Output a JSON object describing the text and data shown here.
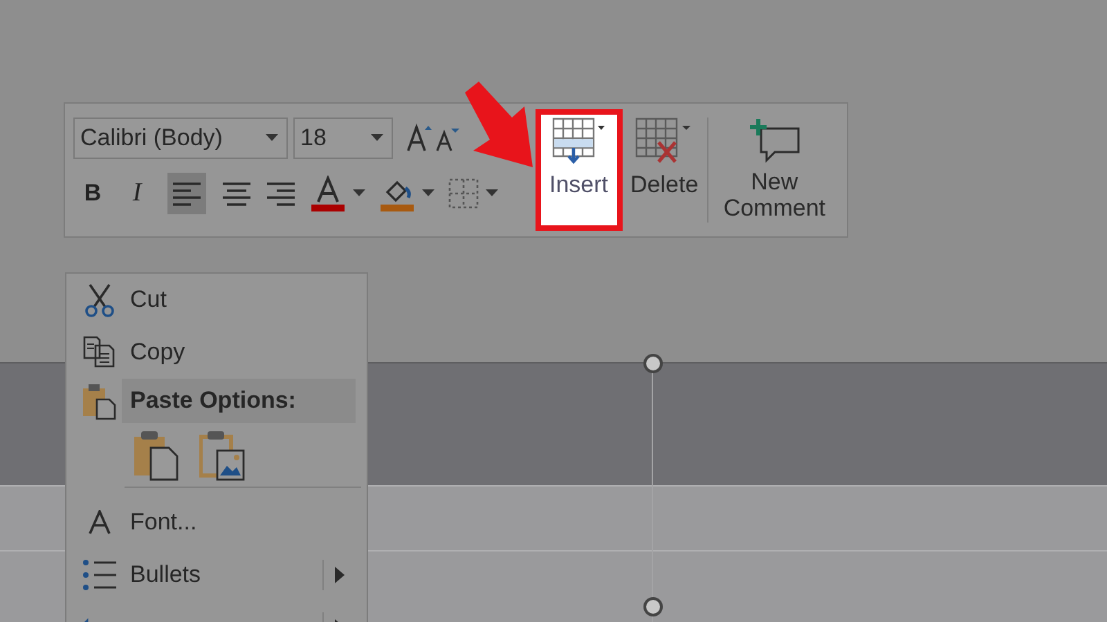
{
  "mini_toolbar": {
    "font_name": {
      "value": "Calibri (Body)"
    },
    "font_size": {
      "value": "18"
    },
    "format_buttons": [
      {
        "kind": "bold",
        "label": "B",
        "selected": false
      },
      {
        "kind": "italic",
        "label": "I",
        "selected": false
      },
      {
        "kind": "align_left",
        "selected": true
      },
      {
        "kind": "align_center",
        "selected": false
      },
      {
        "kind": "align_right",
        "selected": false
      },
      {
        "kind": "font_color",
        "selected": false
      },
      {
        "kind": "highlight",
        "selected": false
      },
      {
        "kind": "borders",
        "selected": false
      }
    ],
    "table_buttons": [
      {
        "kind": "insert",
        "label": "Insert",
        "highlighted": true
      },
      {
        "kind": "delete",
        "label": "Delete",
        "highlighted": false
      },
      {
        "kind": "comment",
        "label": "New Comment",
        "highlighted": false
      }
    ]
  },
  "context_menu": {
    "items": [
      {
        "kind": "command",
        "label": "Cut"
      },
      {
        "kind": "command",
        "label": "Copy"
      },
      {
        "kind": "header",
        "label": "Paste Options:"
      },
      {
        "kind": "paste_buttons"
      },
      {
        "kind": "command",
        "label": "Font..."
      },
      {
        "kind": "submenu",
        "label": "Bullets"
      },
      {
        "kind": "submenu"
      }
    ]
  }
}
